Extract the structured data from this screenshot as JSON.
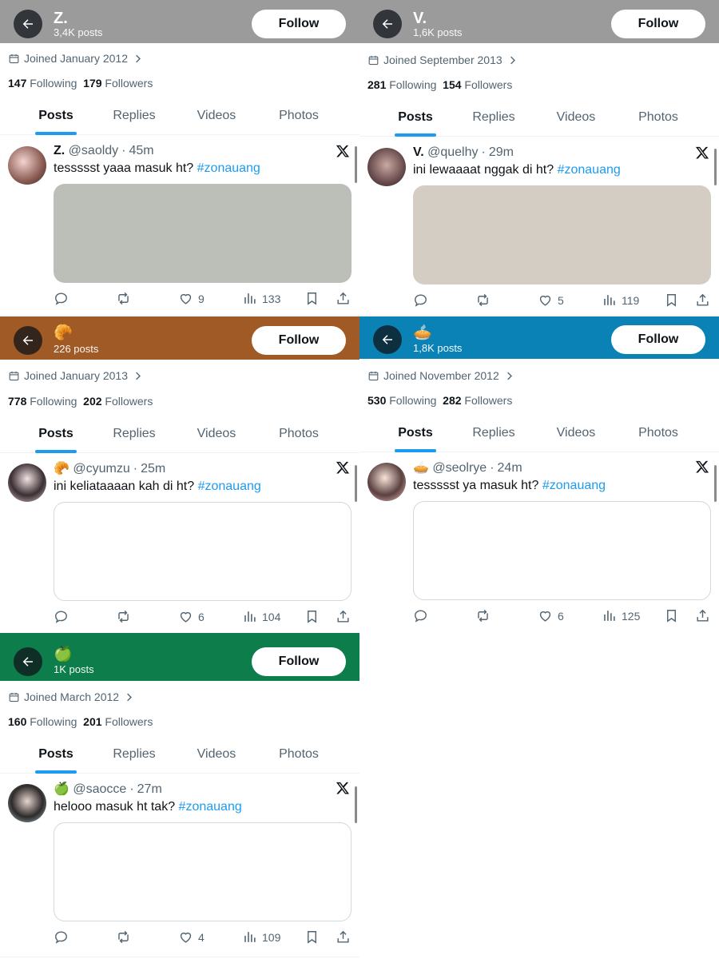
{
  "common": {
    "follow_label": "Follow",
    "following_label": "Following",
    "followers_label": "Followers",
    "tabs": [
      "Posts",
      "Replies",
      "Videos",
      "Photos"
    ],
    "dot": "·"
  },
  "profiles": [
    {
      "banner_color": "#9b9b9b",
      "display_name": "Z.",
      "posts_count": "3,4K posts",
      "joined": "Joined January 2012",
      "following": "147",
      "followers": "179",
      "post": {
        "name": "Z.",
        "handle": "@saoldy",
        "time": "45m",
        "text": "tessssst yaaa masuk ht? ",
        "hashtag": "#zonauang",
        "media_color": "#bbbfb8",
        "replies": "",
        "reposts": "",
        "likes": "9",
        "views": "133"
      }
    },
    {
      "banner_color": "#9b9b9b",
      "display_name": "V.",
      "posts_count": "1,6K posts",
      "joined": "Joined September 2013",
      "following": "281",
      "followers": "154",
      "post": {
        "name": "V.",
        "handle": "@quelhy",
        "time": "29m",
        "text": "ini lewaaaat nggak di ht? ",
        "hashtag": "#zonauang",
        "media_color": "#d4cdc3",
        "replies": "",
        "reposts": "",
        "likes": "5",
        "views": "119"
      }
    },
    {
      "banner_color": "#a05a26",
      "emoji": "🥐",
      "posts_count": "226 posts",
      "joined": "Joined January 2013",
      "following": "778",
      "followers": "202",
      "post": {
        "emoji": "🥐",
        "handle": "@cyumzu",
        "time": "25m",
        "text": "ini keliataaaan kah di ht? ",
        "hashtag": "#zonauang",
        "media_color": "#ffffff",
        "likes": "6",
        "views": "104"
      }
    },
    {
      "banner_color": "#0a82b6",
      "emoji": "🥧",
      "posts_count": "1,8K posts",
      "joined": "Joined November 2012",
      "following": "530",
      "followers": "282",
      "post": {
        "emoji": "🥧",
        "handle": "@seolrye",
        "time": "24m",
        "text": "tessssst ya masuk ht? ",
        "hashtag": "#zonauang",
        "media_color": "#ffffff",
        "likes": "6",
        "views": "125"
      }
    },
    {
      "banner_color": "#0d7d4b",
      "emoji": "🍏",
      "posts_count": "1K posts",
      "joined": "Joined March 2012",
      "following": "160",
      "followers": "201",
      "post": {
        "emoji": "🍏",
        "handle": "@saocce",
        "time": "27m",
        "text": "helooo masuk ht tak? ",
        "hashtag": "#zonauang",
        "media_color": "#ffffff",
        "likes": "4",
        "views": "109"
      }
    }
  ]
}
